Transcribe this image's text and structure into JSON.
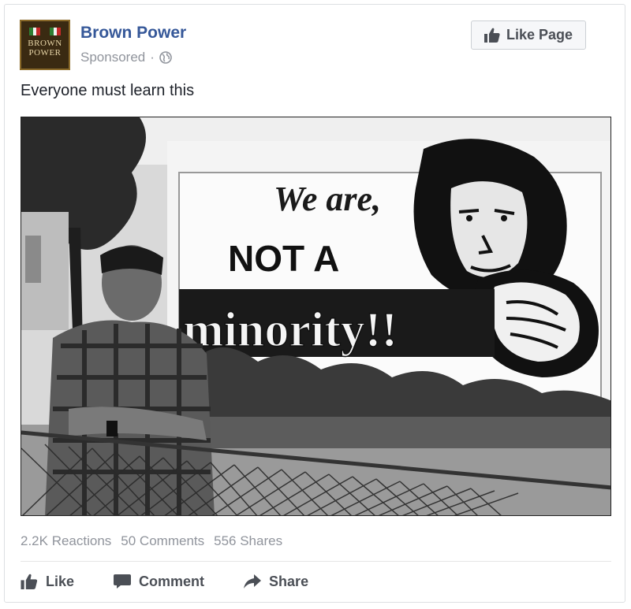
{
  "post": {
    "page_name": "Brown Power",
    "sponsored_label": "Sponsored",
    "separator": "·",
    "avatar_text_line1": "BROWN",
    "avatar_text_line2": "POWER",
    "like_page_label": "Like Page",
    "body_text": "Everyone must learn this"
  },
  "photo": {
    "mural_text_1": "We are,",
    "mural_text_2": "NOT A",
    "mural_text_3": "minority!!"
  },
  "stats": {
    "reactions": "2.2K Reactions",
    "comments": "50 Comments",
    "shares": "556 Shares"
  },
  "actions": {
    "like": "Like",
    "comment": "Comment",
    "share": "Share"
  },
  "icons": {
    "avatar": "brown-power-logo",
    "globe": "globe-icon",
    "like_page": "thumbs-up-icon",
    "like": "thumbs-up-icon",
    "comment": "comment-bubble-icon",
    "share": "share-arrow-icon"
  },
  "colors": {
    "link_blue": "#365899",
    "meta_gray": "#90949c",
    "action_gray": "#4b4f56",
    "button_bg": "#f6f7f9"
  }
}
